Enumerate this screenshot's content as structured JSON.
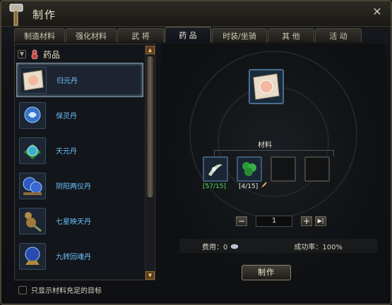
{
  "window": {
    "title": "制作"
  },
  "tabs": [
    {
      "label": "制造材料"
    },
    {
      "label": "强化材料"
    },
    {
      "label": "武 将"
    },
    {
      "label": "药 品"
    },
    {
      "label": "时装/坐骑"
    },
    {
      "label": "其 他"
    },
    {
      "label": "活 动"
    }
  ],
  "category": {
    "label": "药品"
  },
  "items": [
    {
      "label": "归元丹",
      "color": "#d8c8b0"
    },
    {
      "label": "保灵丹",
      "color": "#6aa0e8"
    },
    {
      "label": "天元丹",
      "color": "#3ab070"
    },
    {
      "label": "阴阳两仪丹",
      "color": "#4a7ad0"
    },
    {
      "label": "七星映天丹",
      "color": "#b08a4a"
    },
    {
      "label": "九转回魂丹",
      "color": "#3a5ab0"
    }
  ],
  "filter": {
    "label": "只显示材料充足的目标"
  },
  "materials": {
    "title": "材料",
    "slot1_count": "[57/15]",
    "slot2_count": "[4/15]"
  },
  "quantity": {
    "value": "1",
    "minus": "−",
    "plus": "+",
    "max": "▶|"
  },
  "info": {
    "cost": "费用：0",
    "success": "成功率：100%"
  },
  "make_button": {
    "label": "制作"
  },
  "colors": {
    "link": "#6ec1ff",
    "enough": "#55e05a",
    "frame": "#4a4436"
  }
}
